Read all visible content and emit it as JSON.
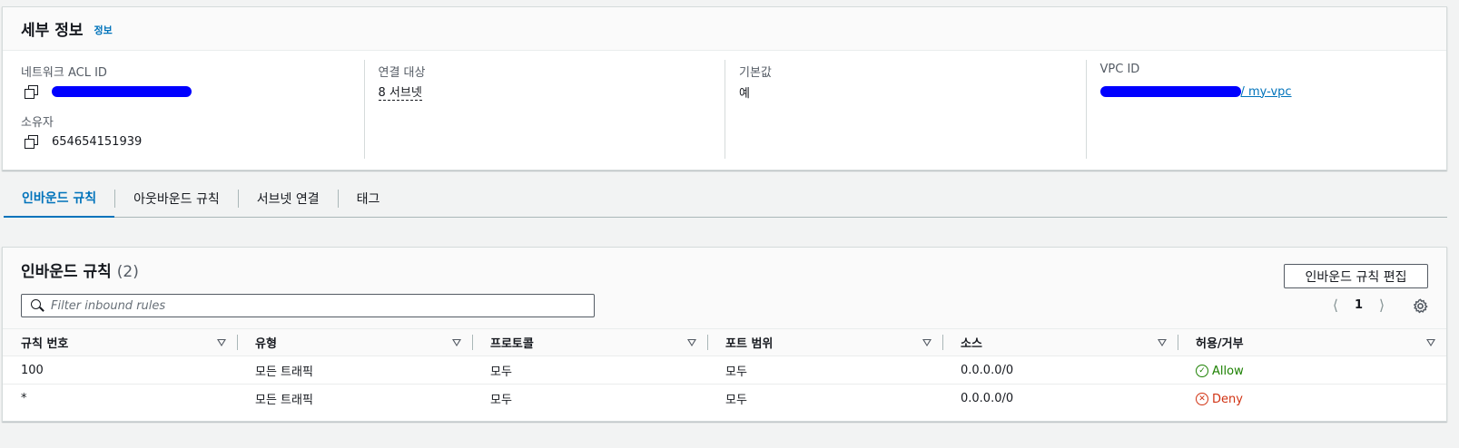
{
  "details": {
    "title": "세부 정보",
    "info_link": "정보",
    "acl_id_label": "네트워크 ACL ID",
    "owner_label": "소유자",
    "owner_value": "654654151939",
    "assoc_label": "연결 대상",
    "assoc_value": "8 서브넷",
    "default_label": "기본값",
    "default_value": "예",
    "vpc_label": "VPC ID",
    "vpc_value_suffix": " / my-vpc"
  },
  "tabs": [
    {
      "label": "인바운드 규칙",
      "active": true
    },
    {
      "label": "아웃바운드 규칙",
      "active": false
    },
    {
      "label": "서브넷 연결",
      "active": false
    },
    {
      "label": "태그",
      "active": false
    }
  ],
  "rules": {
    "title": "인바운드 규칙",
    "count": "(2)",
    "edit_button": "인바운드 규칙 편집",
    "filter_placeholder": "Filter inbound rules",
    "page": "1",
    "columns": [
      "규칙 번호",
      "유형",
      "프로토콜",
      "포트 범위",
      "소스",
      "허용/거부"
    ],
    "rows": [
      {
        "rule": "100",
        "type": "모든 트래픽",
        "protocol": "모두",
        "port": "모두",
        "source": "0.0.0.0/0",
        "action": "Allow"
      },
      {
        "rule": "*",
        "type": "모든 트래픽",
        "protocol": "모두",
        "port": "모두",
        "source": "0.0.0.0/0",
        "action": "Deny"
      }
    ]
  },
  "icons": {
    "copy": "copy-icon",
    "search": "search-icon",
    "settings": "gear-icon",
    "allow": "check-circle-icon",
    "deny": "x-circle-icon"
  },
  "colors": {
    "link": "#0073bb",
    "allow": "#1d8102",
    "deny": "#d13212",
    "redaction": "#0000ff"
  }
}
